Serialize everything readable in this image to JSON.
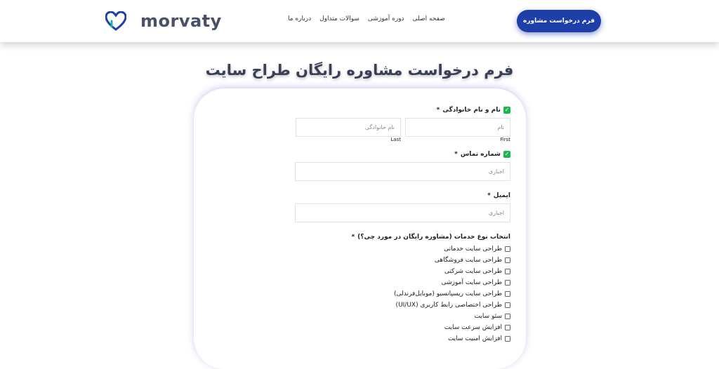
{
  "header": {
    "logo_text": "morvaty",
    "nav": [
      "صفحه اصلی",
      "دوره آموزشی",
      "سوالات متداول",
      "درباره ما"
    ],
    "cta_label": "فرم درخواست مشاوره"
  },
  "page_title": "فرم درخواست مشاوره رایگان طراح سایت",
  "form": {
    "name_label": "نام و نام خانوادگی",
    "required_mark": "*",
    "first_placeholder": "نام",
    "last_placeholder": "نام خانوادگی",
    "first_sub": "First",
    "last_sub": "Last",
    "phone_label": "شماره تماس",
    "phone_placeholder": "اجباری",
    "email_label": "ایمیل",
    "email_placeholder": "اجباری",
    "services_label": "انتخاب نوع خدمات (مشاوره رایگان در مورد چی؟)",
    "services": [
      "طراحی سایت خدماتی",
      "طراحی سایت فروشگاهی",
      "طراحی سایت شرکتی",
      "طراحی سایت آموزشی",
      "طراحی سایت ریسپانسیو (موبایل‌فرندلی)",
      "طراحی اختصاصی رابط کاربری (UI/UX)",
      "سئو سایت",
      "افزایش سرعت سایت",
      "افزایش امنیت سایت"
    ]
  },
  "colors": {
    "brand_blue": "#1e3fa8",
    "accent_teal": "#14b8a6",
    "check_green": "#1fb64c"
  }
}
